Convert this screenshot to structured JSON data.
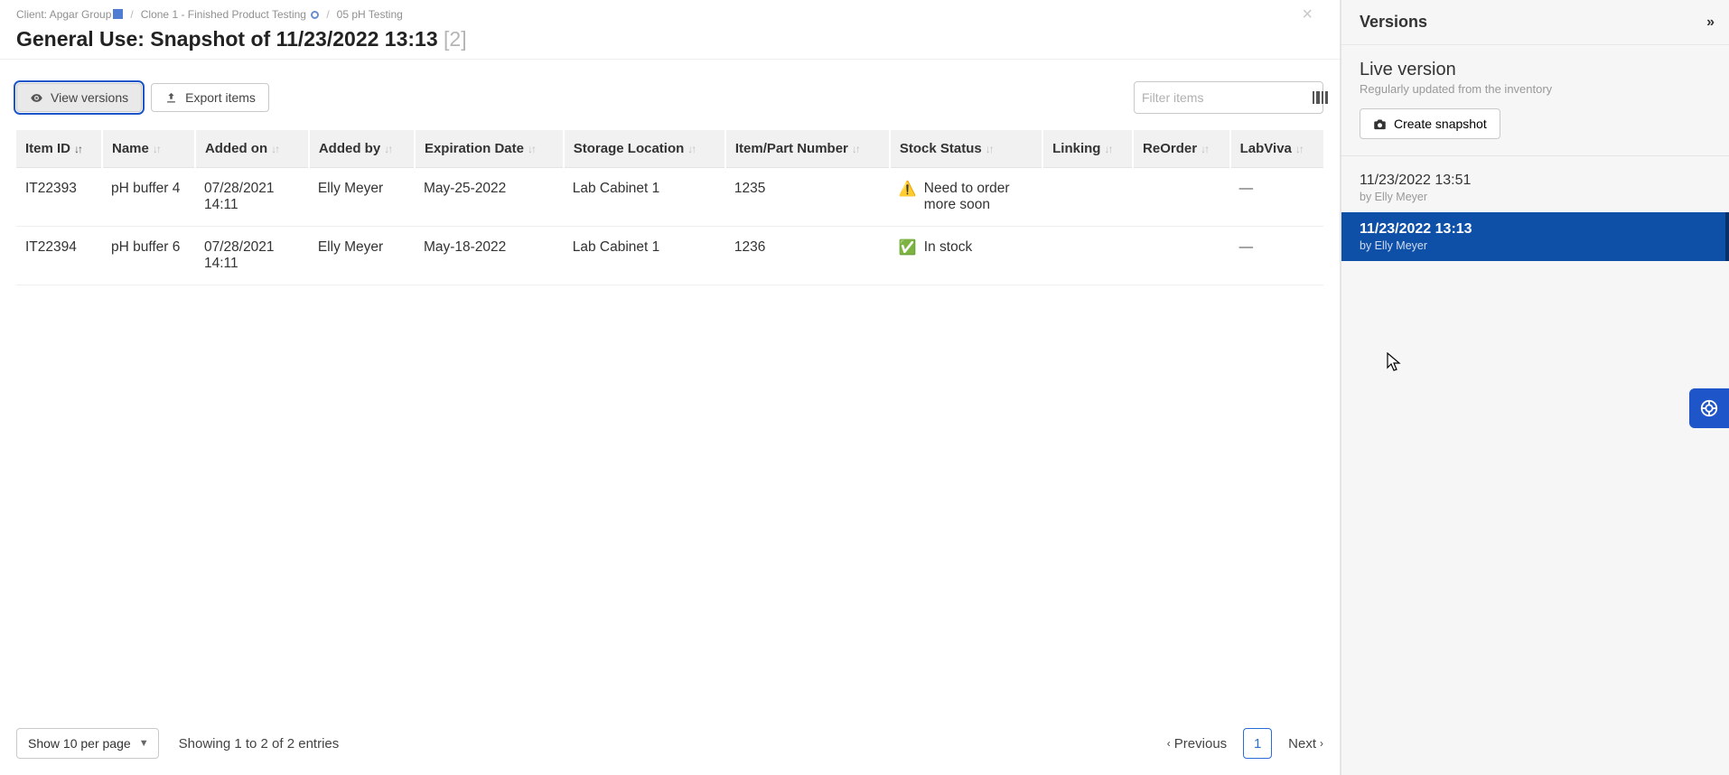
{
  "breadcrumb": {
    "client_label": "Client: Apgar Group",
    "item2": "Clone 1 - Finished Product Testing",
    "item3": "05 pH Testing"
  },
  "title": {
    "prefix": "General Use:",
    "snapshot": "Snapshot of 11/23/2022 13:13",
    "count": "[2]"
  },
  "toolbar": {
    "view_versions": "View versions",
    "export_items": "Export items",
    "search_placeholder": "Filter items"
  },
  "columns": [
    "Item ID",
    "Name",
    "Added on",
    "Added by",
    "Expiration Date",
    "Storage Location",
    "Item/Part Number",
    "Stock Status",
    "Linking",
    "ReOrder",
    "LabViva"
  ],
  "rows": [
    {
      "item_id": "IT22393",
      "name": "pH buffer 4",
      "added_on": "07/28/2021 14:11",
      "added_by": "Elly Meyer",
      "expiration": "May-25-2022",
      "storage": "Lab Cabinet 1",
      "part_number": "1235",
      "stock_icon": "⚠️",
      "stock_text": "Need to order more soon",
      "linking": "",
      "reorder": "",
      "labviva": "—"
    },
    {
      "item_id": "IT22394",
      "name": "pH buffer 6",
      "added_on": "07/28/2021 14:11",
      "added_by": "Elly Meyer",
      "expiration": "May-18-2022",
      "storage": "Lab Cabinet 1",
      "part_number": "1236",
      "stock_icon": "✅",
      "stock_text": "In stock",
      "linking": "",
      "reorder": "",
      "labviva": "—"
    }
  ],
  "footer": {
    "page_size": "Show 10 per page",
    "entries": "Showing 1 to 2 of 2 entries",
    "prev": "Previous",
    "page": "1",
    "next": "Next"
  },
  "sidebar": {
    "title": "Versions",
    "live_title": "Live version",
    "live_sub": "Regularly updated from the inventory",
    "create_snapshot": "Create snapshot",
    "versions": [
      {
        "ts": "11/23/2022 13:51",
        "by": "by Elly Meyer",
        "selected": false
      },
      {
        "ts": "11/23/2022 13:13",
        "by": "by Elly Meyer",
        "selected": true
      }
    ]
  }
}
